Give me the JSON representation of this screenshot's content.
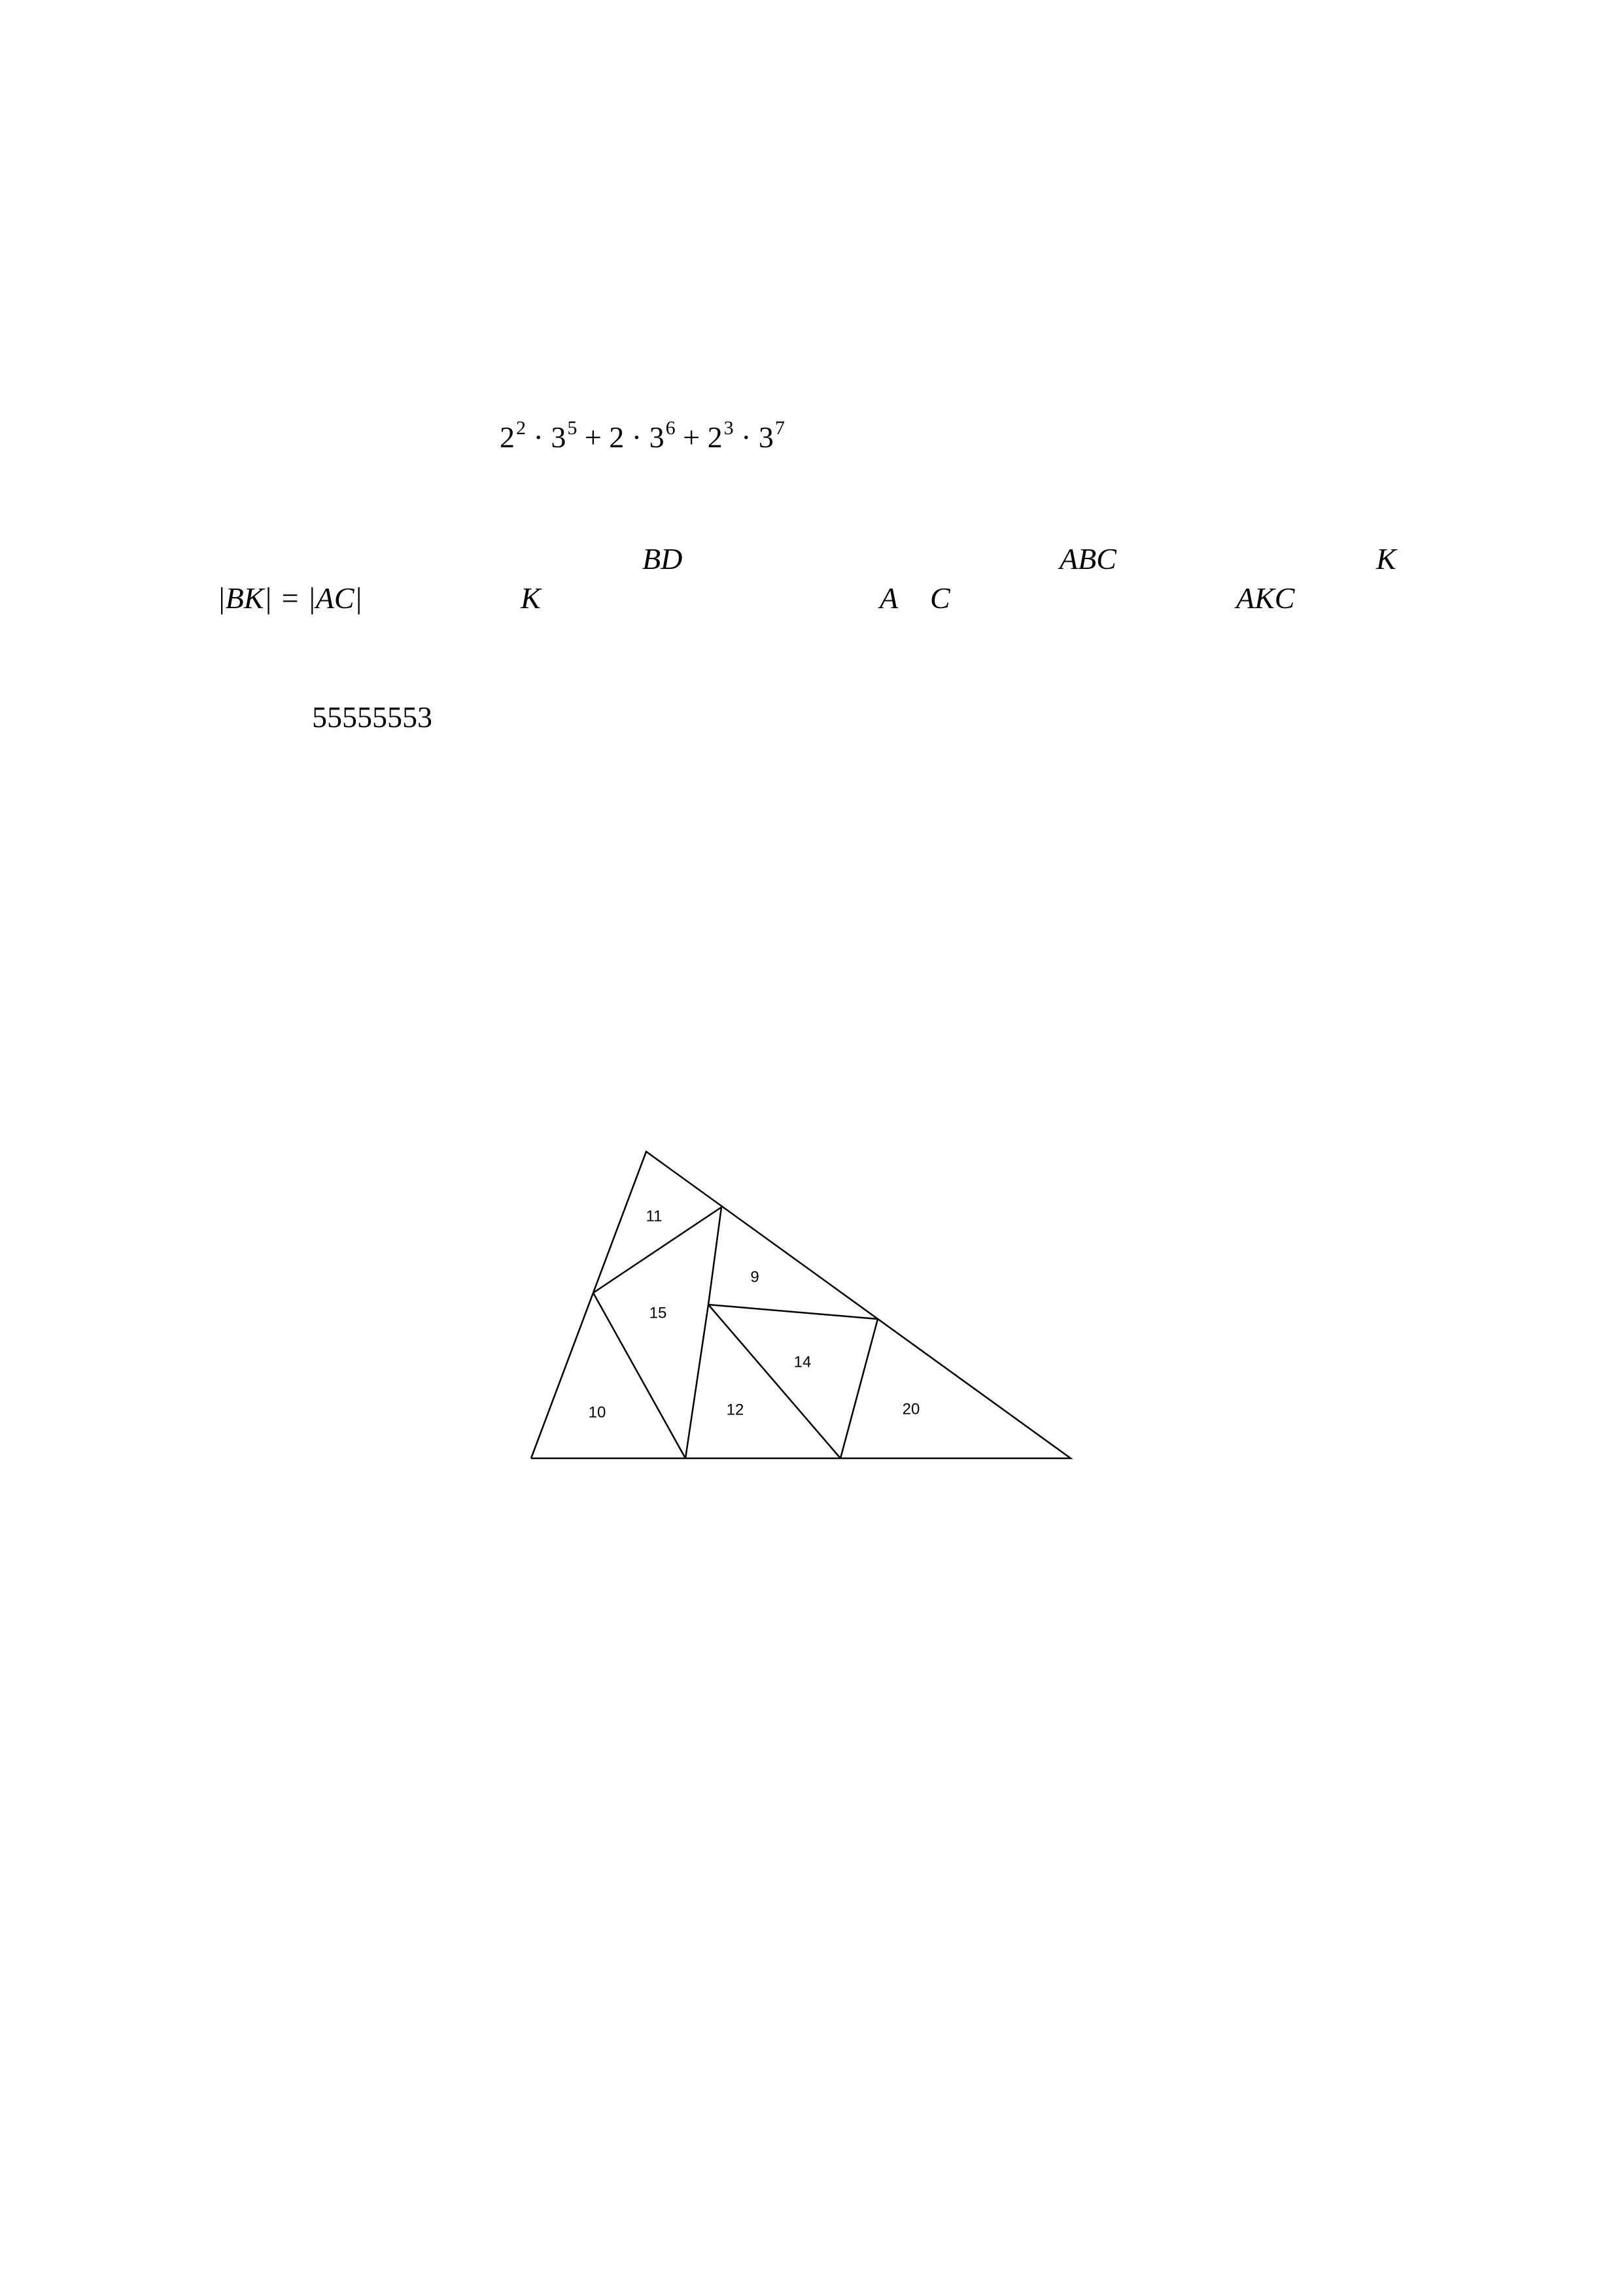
{
  "problem1": {
    "expression": {
      "t1_base_a": "2",
      "t1_exp_a": "2",
      "t1_base_b": "3",
      "t1_exp_b": "5",
      "op1": "+",
      "t2_coef": "2",
      "t2_base": "3",
      "t2_exp": "6",
      "op2": "+",
      "t3_base_a": "2",
      "t3_exp_a": "3",
      "t3_base_b": "3",
      "t3_exp_b": "7"
    }
  },
  "problem2": {
    "line1": {
      "bd": "BD",
      "abc": "ABC",
      "k": "K"
    },
    "line2": {
      "bk_eq_ac": "|BK| = |AC|",
      "k": "K",
      "a": "A",
      "c": "C",
      "akc": "AKC"
    }
  },
  "problem3": {
    "number": "55555553"
  },
  "figure": {
    "labels": [
      "11",
      "9",
      "15",
      "14",
      "10",
      "12",
      "20"
    ]
  }
}
